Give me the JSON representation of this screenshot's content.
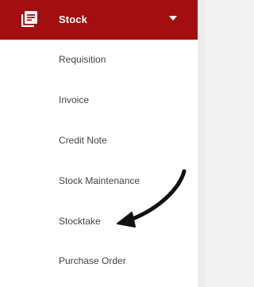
{
  "header": {
    "icon": "stacked-documents-icon",
    "title": "Stock",
    "expand_icon": "caret-down-icon"
  },
  "menu": {
    "items": [
      {
        "label": "Requisition"
      },
      {
        "label": "Invoice"
      },
      {
        "label": "Credit Note"
      },
      {
        "label": "Stock Maintenance"
      },
      {
        "label": "Stocktake"
      },
      {
        "label": "Purchase Order"
      }
    ]
  },
  "annotation": {
    "icon": "curved-arrow-icon",
    "points_to": "Stocktake"
  },
  "colors": {
    "header_bg": "#a30f0f",
    "header_text": "#ffffff",
    "item_text": "#444444",
    "background": "#ffffff"
  }
}
